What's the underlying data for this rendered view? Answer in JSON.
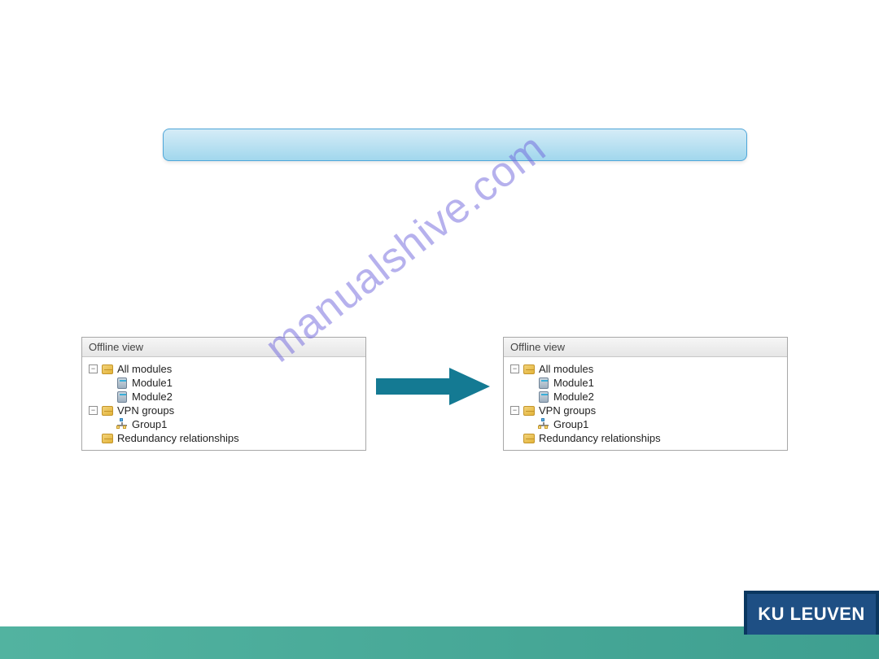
{
  "title_bar": "",
  "panel_left": {
    "header": "Offline view",
    "nodes": {
      "all_modules": "All modules",
      "module1": "Module1",
      "module2": "Module2",
      "vpn_groups": "VPN groups",
      "group1": "Group1",
      "redundancy": "Redundancy relationships"
    }
  },
  "panel_right": {
    "header": "Offline view",
    "nodes": {
      "all_modules": "All modules",
      "module1": "Module1",
      "module2": "Module2",
      "vpn_groups": "VPN groups",
      "group1": "Group1",
      "redundancy": "Redundancy relationships"
    }
  },
  "watermark": "manualshive.com",
  "footer_logo": "KU LEUVEN"
}
